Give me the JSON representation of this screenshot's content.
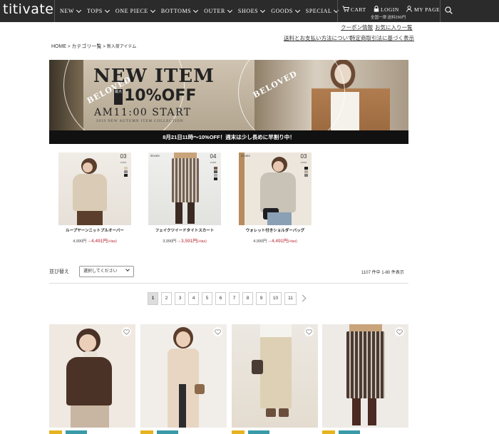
{
  "header": {
    "logo": "titivate",
    "nav": [
      {
        "label": "NEW"
      },
      {
        "label": "TOPS"
      },
      {
        "label": "ONE PIECE"
      },
      {
        "label": "BOTTOMS"
      },
      {
        "label": "OUTER"
      },
      {
        "label": "SHOES"
      },
      {
        "label": "GOODS"
      },
      {
        "label": "SPECIAL"
      }
    ],
    "cart_label": "CART",
    "login_label": "LOGIN",
    "mypage_label": "MY PAGE",
    "shipping_note": "全国一律 送料290円"
  },
  "sublinks": {
    "coupon": "クーポン情報",
    "favorites": "お気に入り一覧",
    "shipping": "送料とお支払い方法について",
    "law": "特定商取引法に基づく表示"
  },
  "breadcrumb": {
    "home": "HOME",
    "category": "カテゴリ一覧",
    "current": "新入荷アイテム",
    "sep": ">"
  },
  "banner": {
    "title": "NEW ITEM",
    "discount": "10%OFF",
    "tag": "最大",
    "start": "AM11:00 START",
    "sub": "2019 NEW AUTUMN ITEM COLLECTION",
    "ring_left": "BELOVED",
    "ring_right": "BELOVED",
    "caption": "8月21日11時～10%OFF！週末は少し長めに早割り中！"
  },
  "featured": [
    {
      "name": "ループヤーンニットプルオーバー",
      "regular": "4,990円",
      "arrow": "→",
      "sale": "4,491円",
      "tax": "(+tax)",
      "count": "03",
      "count_label": "color",
      "brand": ""
    },
    {
      "name": "フェイクツイードタイトスカート",
      "regular": "3,990円",
      "arrow": "→",
      "sale": "3,591円",
      "tax": "(+tax)",
      "count": "04",
      "count_label": "color",
      "brand": "titivate"
    },
    {
      "name": "ウォレット付きショルダーバッグ",
      "regular": "4,990円",
      "arrow": "→",
      "sale": "4,491円",
      "tax": "(+tax)",
      "count": "03",
      "count_label": "color",
      "brand": "titivate"
    }
  ],
  "sort": {
    "label": "並び替え",
    "selected": "選択してください"
  },
  "results": "1107 件中 1-80 件表示",
  "pagination": [
    "1",
    "2",
    "3",
    "4",
    "5",
    "6",
    "7",
    "8",
    "9",
    "10",
    "11"
  ],
  "colors": {
    "header_bg": "#2b2b2b",
    "sale_red": "#b8232f",
    "badge_yellow": "#e6b422",
    "badge_teal": "#3a9aa8"
  }
}
